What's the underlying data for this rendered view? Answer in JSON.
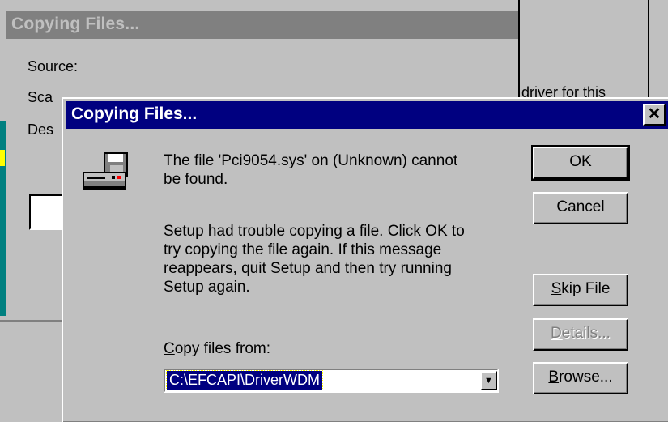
{
  "background_window": {
    "title": "Copying Files...",
    "labels": [
      "Source:",
      "Sca",
      "Des"
    ]
  },
  "right_window": {
    "partial_text": "driver for this"
  },
  "dialog": {
    "title": "Copying Files...",
    "close_glyph": "✕",
    "icon": "disk-drive-icon",
    "message_lines": [
      "The file 'Pci9054.sys' on (Unknown) cannot",
      "be found.",
      "Setup had trouble copying a file. Click OK to",
      "try copying the file again. If this message",
      "reappears, quit Setup and then try running",
      "Setup again."
    ],
    "copy_from": {
      "label_accel": "C",
      "label_rest": "opy files from:",
      "value": "C:\\EFCAPI\\DriverWDM",
      "arrow_glyph": "▼"
    },
    "buttons": {
      "ok": "OK",
      "cancel": "Cancel",
      "skip_accel": "S",
      "skip_rest": "kip File",
      "details_accel": "D",
      "details_rest": "etails...",
      "browse_accel": "B",
      "browse_rest": "rowse..."
    }
  },
  "colors": {
    "titlebar_active": "#000080",
    "titlebar_inactive": "#808080",
    "face": "#c0c0c0"
  }
}
